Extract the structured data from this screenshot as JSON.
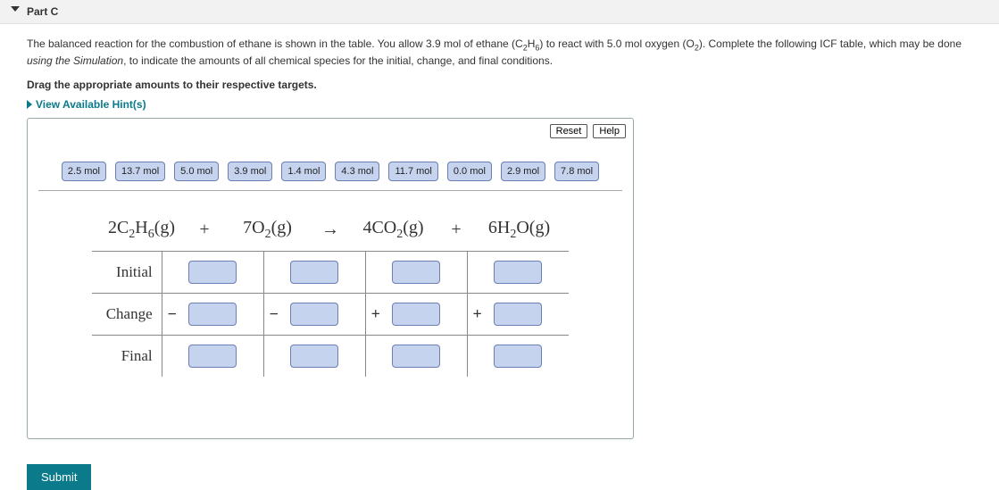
{
  "header": {
    "part_label": "Part C"
  },
  "prompt": {
    "text_pre": "The balanced reaction for the combustion of ethane is shown in the table. You allow 3.9 ",
    "mol1": "mol",
    "text_mid1": " of ethane (C",
    "sub1": "2",
    "text_mid1b": "H",
    "sub1b": "6",
    "text_mid2": ") to react with 5.0 ",
    "mol2": "mol",
    "text_mid3": " oxygen (O",
    "sub2": "2",
    "text_mid4": "). Complete the following ICF table, which may be done ",
    "sim": "using the Simulation",
    "text_end": ", to indicate the amounts of all chemical species for the initial, change, and final conditions."
  },
  "instruction": "Drag the appropriate amounts to their respective targets.",
  "hints_label": "View Available Hint(s)",
  "panel_buttons": {
    "reset": "Reset",
    "help": "Help"
  },
  "chips": [
    "2.5 mol",
    "13.7 mol",
    "5.0 mol",
    "3.9 mol",
    "1.4 mol",
    "4.3 mol",
    "11.7 mol",
    "0.0 mol",
    "2.9 mol",
    "7.8 mol"
  ],
  "equation": {
    "t1a": "2C",
    "t1s1": "2",
    "t1b": "H",
    "t1s2": "6",
    "t1c": "(g)",
    "plus": "+",
    "t2a": "7O",
    "t2s": "2",
    "t2b": "(g)",
    "arrow": "→",
    "t3a": "4CO",
    "t3s": "2",
    "t3b": "(g)",
    "t4a": "6H",
    "t4s": "2",
    "t4b": "O(g)"
  },
  "rows": {
    "initial": "Initial",
    "change": "Change",
    "final": "Final",
    "minus": "−",
    "plus_sign": "+"
  },
  "submit": "Submit"
}
